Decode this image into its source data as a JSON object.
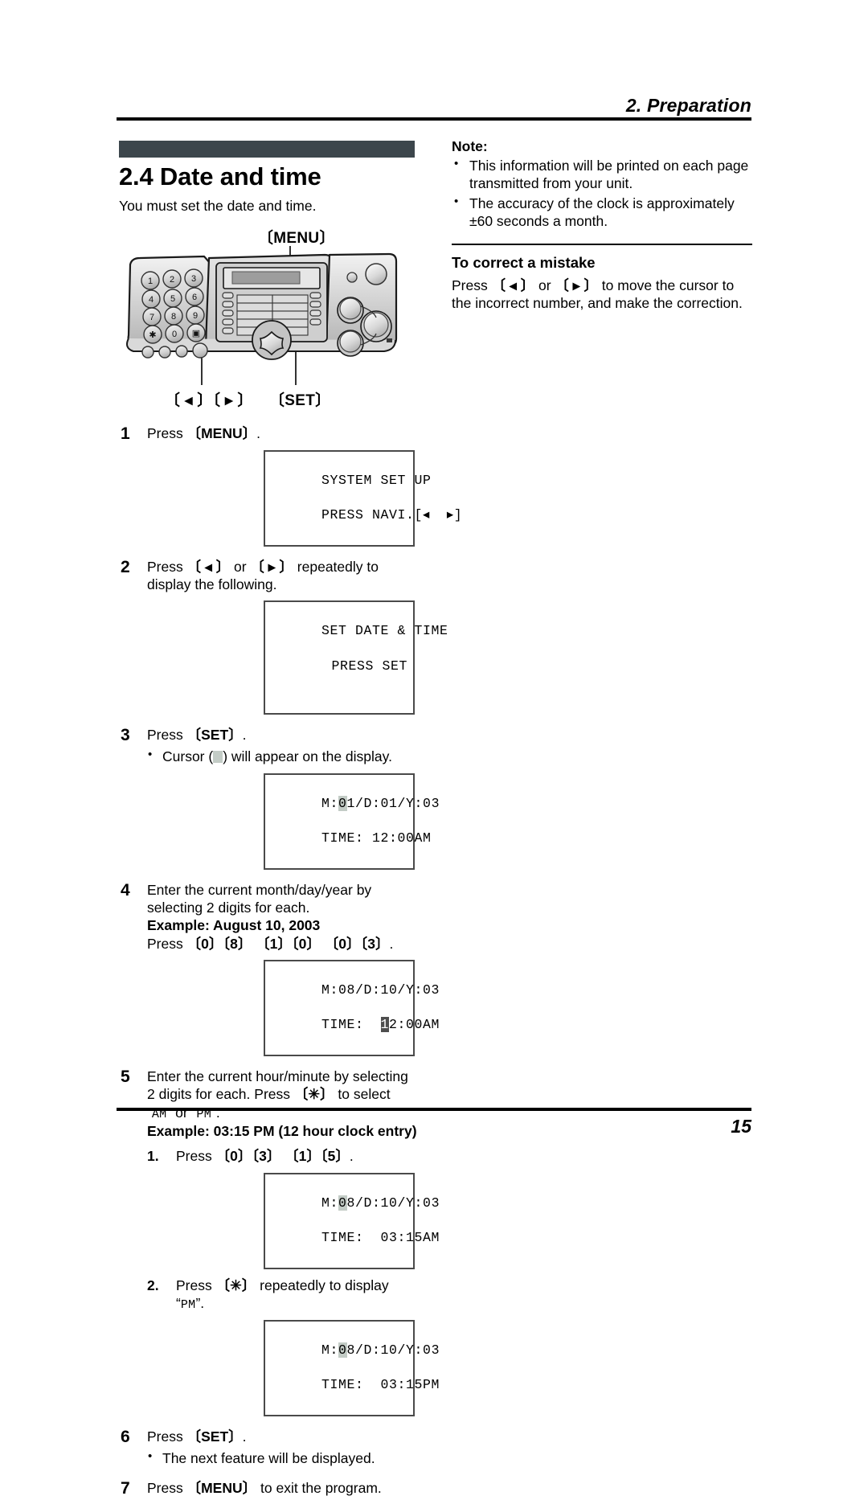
{
  "header": {
    "running_head": "2. Preparation"
  },
  "footer": {
    "page_number": "15"
  },
  "section": {
    "title": "2.4 Date and time",
    "intro": "You must set the date and time.",
    "bar_color": "#3c464c"
  },
  "illustration": {
    "alt": "fax machine control panel",
    "callouts": {
      "menu": "〔MENU〕",
      "navigator": "〔 ◂ 〕〔 ▸ 〕",
      "set": "〔SET〕"
    },
    "keypad_labels": [
      "1",
      "2",
      "3",
      "4",
      "5",
      "6",
      "7",
      "8",
      "9",
      "✳",
      "0",
      "▣"
    ]
  },
  "steps": [
    {
      "num": "1",
      "text_pre": "Press ",
      "key": "〔MENU〕",
      "text_post": "."
    },
    {
      "num": "2",
      "text_pre": "Press ",
      "key1": "〔 ◂ 〕",
      "mid": " or ",
      "key2": "〔 ▸ 〕",
      "text_post": " repeatedly to display the following."
    },
    {
      "num": "3",
      "text_pre": "Press ",
      "key": "〔SET〕",
      "text_post": ".",
      "bullet_pre": "Cursor (",
      "bullet_post": ") will appear on the display."
    },
    {
      "num": "4",
      "line1": "Enter the current month/day/year by selecting 2 digits for each.",
      "example": "Example: August 10, 2003",
      "press_pre": "Press ",
      "press_keys": "〔0〕〔8〕 〔1〕〔0〕 〔0〕〔3〕",
      "press_post": "."
    },
    {
      "num": "5",
      "line1_a": "Enter the current hour/minute by selecting 2 digits for each. Press ",
      "line1_key": "〔✳〕",
      "line1_b": " to select “",
      "line1_am": "AM",
      "line1_c": "” or “",
      "line1_pm": "PM",
      "line1_d": "”.",
      "example": "Example: 03:15 PM (12 hour clock entry)",
      "sub1_num": "1.",
      "sub1_pre": "Press ",
      "sub1_keys": "〔0〕〔3〕 〔1〕〔5〕",
      "sub1_post": ".",
      "sub2_num": "2.",
      "sub2_pre": "Press ",
      "sub2_key": "〔✳〕",
      "sub2_mid": " repeatedly to display “",
      "sub2_pm": "PM",
      "sub2_post": "”."
    },
    {
      "num": "6",
      "text_pre": "Press ",
      "key": "〔SET〕",
      "text_post": ".",
      "bullet": "The next feature will be displayed."
    },
    {
      "num": "7",
      "text_pre": "Press ",
      "key": "〔MENU〕",
      "text_post": " to exit the program."
    }
  ],
  "lcd": {
    "d1": {
      "line1": "SYSTEM SET UP",
      "line2": "PRESS NAVI.[◂  ▸]"
    },
    "d2": {
      "line1": "SET DATE & TIME",
      "line2": "PRESS SET"
    },
    "d3": {
      "a": "M:",
      "hl": "0",
      "b": "1/D:01/Y:03",
      "line2": "TIME: 12:00AM"
    },
    "d4": {
      "line1": "M:08/D:10/Y:03",
      "a": "TIME:  ",
      "hl": "1",
      "b": "2:00AM"
    },
    "d5": {
      "a": "M:",
      "hl": "0",
      "b": "8/D:10/Y:03",
      "line2": "TIME:  03:15AM"
    },
    "d6": {
      "a": "M:",
      "hl": "0",
      "b": "8/D:10/Y:03",
      "line2": "TIME:  03:15PM"
    }
  },
  "note": {
    "title": "Note:",
    "items": [
      "This information will be printed on each page transmitted from your unit.",
      "The accuracy of the clock is approximately ±60 seconds a month."
    ]
  },
  "correct": {
    "title": "To correct a mistake",
    "pre": "Press ",
    "key1": "〔 ◂ 〕",
    "mid": " or ",
    "key2": "〔 ▸ 〕",
    "post": " to move the cursor to the incorrect number, and make the correction."
  }
}
